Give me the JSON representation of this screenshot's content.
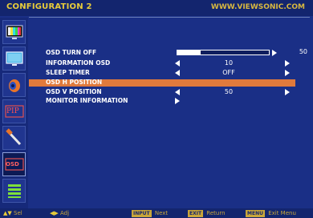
{
  "header": {
    "title": "CONFIGURATION 2",
    "url": "WWW.VIEWSONIC.COM"
  },
  "sidebar": {
    "items": [
      {
        "name": "picture",
        "icon": "tv-color-bars-icon"
      },
      {
        "name": "screen",
        "icon": "monitor-screen-icon"
      },
      {
        "name": "audio",
        "icon": "audio-speaker-icon"
      },
      {
        "name": "pip",
        "icon": "pip-icon",
        "label": "PIP"
      },
      {
        "name": "tools",
        "icon": "tools-icon"
      },
      {
        "name": "osd",
        "icon": "osd-icon",
        "label": "OSD",
        "active": true
      },
      {
        "name": "more",
        "icon": "list-icon"
      }
    ]
  },
  "menu": {
    "items": [
      {
        "label": "OSD TURN OFF",
        "value": "50",
        "control": "slider",
        "level": 0.25
      },
      {
        "label": "INFORMATION OSD",
        "value": "10",
        "control": "select"
      },
      {
        "label": "SLEEP TIMER",
        "value": "OFF",
        "control": "select"
      },
      {
        "label": "OSD H POSITION",
        "value": "",
        "control": "highlight",
        "selected": true
      },
      {
        "label": "OSD V POSITION",
        "value": "50",
        "control": "select"
      },
      {
        "label": "MONITOR INFORMATION",
        "value": "",
        "control": "submenu"
      }
    ]
  },
  "footer": {
    "sel_key": "▲▼",
    "sel_label": "Sel",
    "adj_key": "◀▶",
    "adj_label": "Adj",
    "next_key": "INPUT",
    "next_label": "Next",
    "return_key": "EXIT",
    "return_label": "Return",
    "exit_key": "MENU",
    "exit_label": "Exit Menu"
  },
  "colors": {
    "background": "#1a2f86",
    "highlight": "#e07a3c",
    "title": "#e8cc3a"
  }
}
